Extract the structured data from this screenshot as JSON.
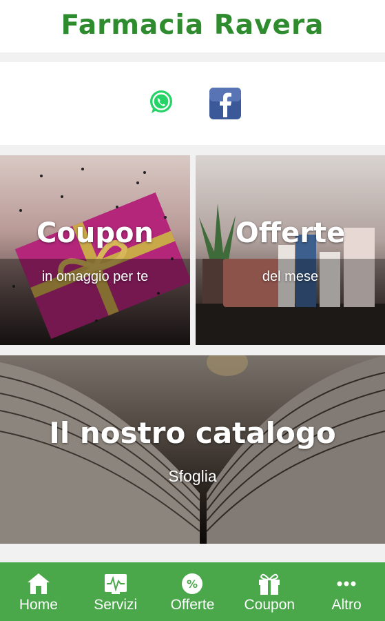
{
  "header": {
    "title": "Farmacia Ravera"
  },
  "social": {
    "whatsapp_icon": "whatsapp-icon",
    "facebook_icon": "facebook-icon"
  },
  "tiles": {
    "coupon": {
      "title": "Coupon",
      "subtitle": "in omaggio per te"
    },
    "offerte": {
      "title": "Offerte",
      "subtitle": "del mese"
    },
    "catalog": {
      "title": "Il nostro catalogo",
      "subtitle": "Sfoglia"
    }
  },
  "nav": {
    "home": "Home",
    "servizi": "Servizi",
    "offerte": "Offerte",
    "coupon": "Coupon",
    "altro": "Altro"
  },
  "colors": {
    "brand_green": "#2e8b2e",
    "bar_green": "#4aa84a",
    "facebook_blue": "#3b5998",
    "whatsapp_green": "#25d366"
  }
}
